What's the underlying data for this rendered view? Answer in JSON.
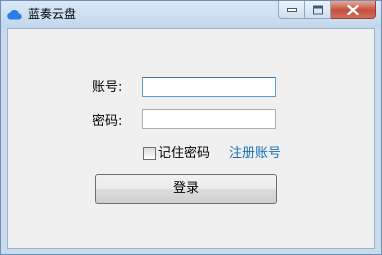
{
  "window": {
    "title": "蓝奏云盘",
    "icon": "cloud-icon",
    "controls": {
      "minimize": "minimize-icon",
      "maximize": "maximize-icon",
      "close": "close-icon"
    }
  },
  "form": {
    "account_label": "账号:",
    "account_value": "",
    "password_label": "密码:",
    "password_value": "",
    "remember_label": "记住密码",
    "remember_checked": false,
    "register_link": "注册账号",
    "login_button": "登录"
  },
  "colors": {
    "link": "#1a6fb5",
    "icon_blue": "#2b7de9",
    "close_red": "#c44e3c"
  }
}
